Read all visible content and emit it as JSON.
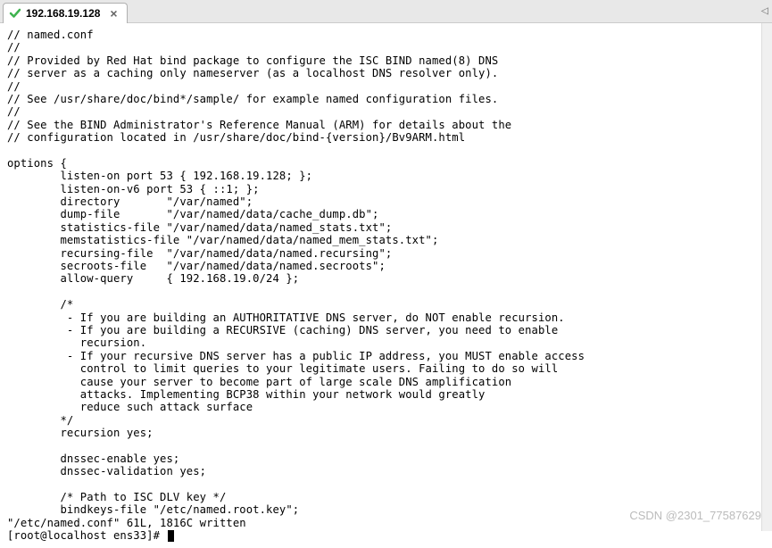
{
  "tab": {
    "title": "192.168.19.128",
    "close_label": "×"
  },
  "terminal": {
    "lines": [
      "// named.conf",
      "//",
      "// Provided by Red Hat bind package to configure the ISC BIND named(8) DNS",
      "// server as a caching only nameserver (as a localhost DNS resolver only).",
      "//",
      "// See /usr/share/doc/bind*/sample/ for example named configuration files.",
      "//",
      "// See the BIND Administrator's Reference Manual (ARM) for details about the",
      "// configuration located in /usr/share/doc/bind-{version}/Bv9ARM.html",
      "",
      "options {",
      "        listen-on port 53 { 192.168.19.128; };",
      "        listen-on-v6 port 53 { ::1; };",
      "        directory       \"/var/named\";",
      "        dump-file       \"/var/named/data/cache_dump.db\";",
      "        statistics-file \"/var/named/data/named_stats.txt\";",
      "        memstatistics-file \"/var/named/data/named_mem_stats.txt\";",
      "        recursing-file  \"/var/named/data/named.recursing\";",
      "        secroots-file   \"/var/named/data/named.secroots\";",
      "        allow-query     { 192.168.19.0/24 };",
      "",
      "        /*",
      "         - If you are building an AUTHORITATIVE DNS server, do NOT enable recursion.",
      "         - If you are building a RECURSIVE (caching) DNS server, you need to enable",
      "           recursion.",
      "         - If your recursive DNS server has a public IP address, you MUST enable access",
      "           control to limit queries to your legitimate users. Failing to do so will",
      "           cause your server to become part of large scale DNS amplification",
      "           attacks. Implementing BCP38 within your network would greatly",
      "           reduce such attack surface",
      "        */",
      "        recursion yes;",
      "",
      "        dnssec-enable yes;",
      "        dnssec-validation yes;",
      "",
      "        /* Path to ISC DLV key */",
      "        bindkeys-file \"/etc/named.root.key\";",
      "\"/etc/named.conf\" 61L, 1816C written",
      "[root@localhost ens33]# "
    ]
  },
  "watermark": "CSDN @2301_77587629",
  "scroll_left_glyph": "◁"
}
